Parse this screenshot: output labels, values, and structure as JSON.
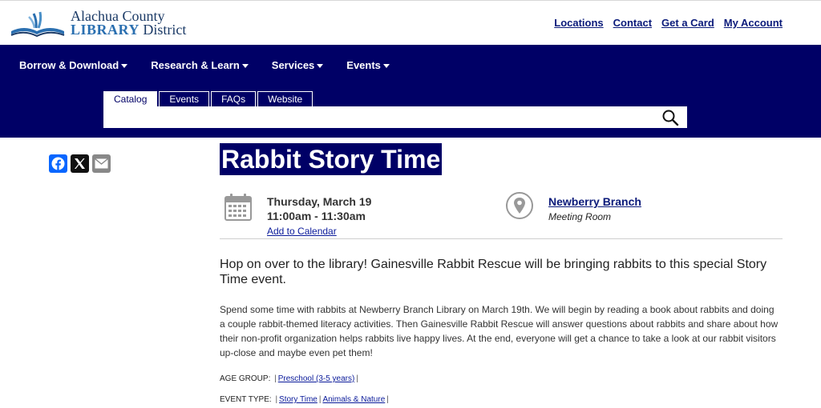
{
  "logo": {
    "line1": "Alachua County",
    "line2_bold": "LIBRARY",
    "line2_rest": " District"
  },
  "top_links": [
    "Locations",
    "Contact",
    "Get a Card",
    "My Account"
  ],
  "main_nav": [
    "Borrow & Download",
    "Research & Learn",
    "Services",
    "Events"
  ],
  "search": {
    "tabs": [
      "Catalog",
      "Events",
      "FAQs",
      "Website"
    ],
    "active_tab": "Catalog",
    "value": "",
    "placeholder": ""
  },
  "share": {
    "icons": [
      "facebook-icon",
      "x-icon",
      "email-icon"
    ],
    "colors": {
      "facebook": "#0866ff",
      "x": "#111111",
      "email": "#888888"
    }
  },
  "event": {
    "title": "Rabbit Story Time",
    "date": "Thursday, March 19",
    "time": "11:00am - 11:30am",
    "add_to_calendar": "Add to Calendar",
    "branch": "Newberry Branch",
    "room": "Meeting Room",
    "lead": "Hop on over to the library! Gainesville Rabbit Rescue will be bringing rabbits to this special Story Time event.",
    "body": "Spend some time with rabbits at Newberry Branch Library on March 19th. We will begin by reading a book about rabbits and doing a couple rabbit-themed literacy activities. Then Gainesville Rabbit Rescue will answer questions about rabbits and share about how their non-profit organization helps rabbits live happy lives. At the end, everyone will get a chance to take a look at our rabbit visitors up-close and maybe even pet them!",
    "age_group_label": "AGE GROUP:",
    "age_groups": [
      "Preschool (3-5 years)"
    ],
    "event_type_label": "EVENT TYPE:",
    "event_types": [
      "Story Time",
      "Animals & Nature"
    ]
  },
  "colors": {
    "nav_bg": "#000066",
    "link": "#0a1a7a",
    "title_bg": "#000066"
  }
}
